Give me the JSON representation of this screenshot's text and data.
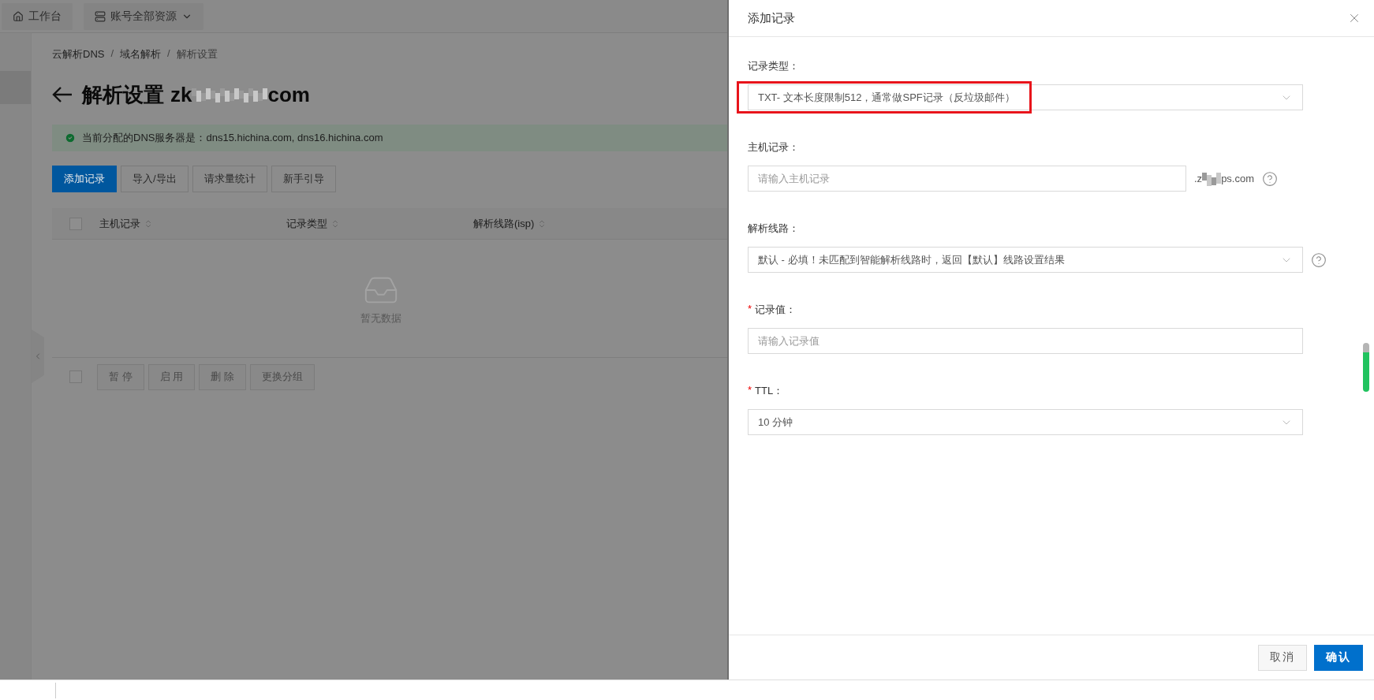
{
  "top_bar": {
    "tabs": [
      {
        "label": "工作台"
      },
      {
        "label": "账号全部资源",
        "dropdown": true
      }
    ]
  },
  "breadcrumb": {
    "separator": "/",
    "items": [
      "云解析DNS",
      "域名解析",
      "解析设置"
    ]
  },
  "page_title": {
    "text": "解析设置",
    "domain_start": "zk",
    "domain_end": "com"
  },
  "alert": "当前分配的DNS服务器是：dns15.hichina.com, dns16.hichina.com",
  "actions": [
    {
      "label": "添加记录",
      "primary": true
    },
    {
      "label": "导入/导出",
      "primary": false
    },
    {
      "label": "请求量统计",
      "primary": false
    },
    {
      "label": "新手引导",
      "primary": false
    }
  ],
  "table": {
    "select_all_checked": false,
    "columns": [
      "主机记录",
      "记录类型",
      "解析线路(isp)"
    ],
    "empty_text": "暂无数据"
  },
  "bulk": {
    "checked": false,
    "buttons": [
      {
        "label": "暂 停",
        "disabled": true
      },
      {
        "label": "启 用",
        "disabled": true
      },
      {
        "label": "删 除",
        "disabled": true
      },
      {
        "label": "更换分组",
        "disabled": true
      }
    ]
  },
  "drawer": {
    "title": "添加记录",
    "fields": [
      {
        "kind": "select",
        "label": "记录类型：",
        "value": "TXT- 文本长度限制512，通常做SPF记录（反垃圾邮件）",
        "highlighted": true
      },
      {
        "kind": "input",
        "label": "主机记录：",
        "placeholder": "请输入主机记录",
        "suffix_start": ".z",
        "suffix_end": "ps.com",
        "help": true
      },
      {
        "kind": "select",
        "label": "解析线路：",
        "value": "默认 - 必填！未匹配到智能解析线路时，返回【默认】线路设置结果",
        "help": true
      },
      {
        "kind": "input",
        "label": "记录值：",
        "required_mark": "*",
        "placeholder": "请输入记录值"
      },
      {
        "kind": "select",
        "label": "TTL：",
        "required_mark": "*",
        "value": "10 分钟"
      }
    ],
    "buttons": [
      {
        "label": "取消",
        "primary": false
      },
      {
        "label": "确认",
        "primary": true
      }
    ]
  }
}
